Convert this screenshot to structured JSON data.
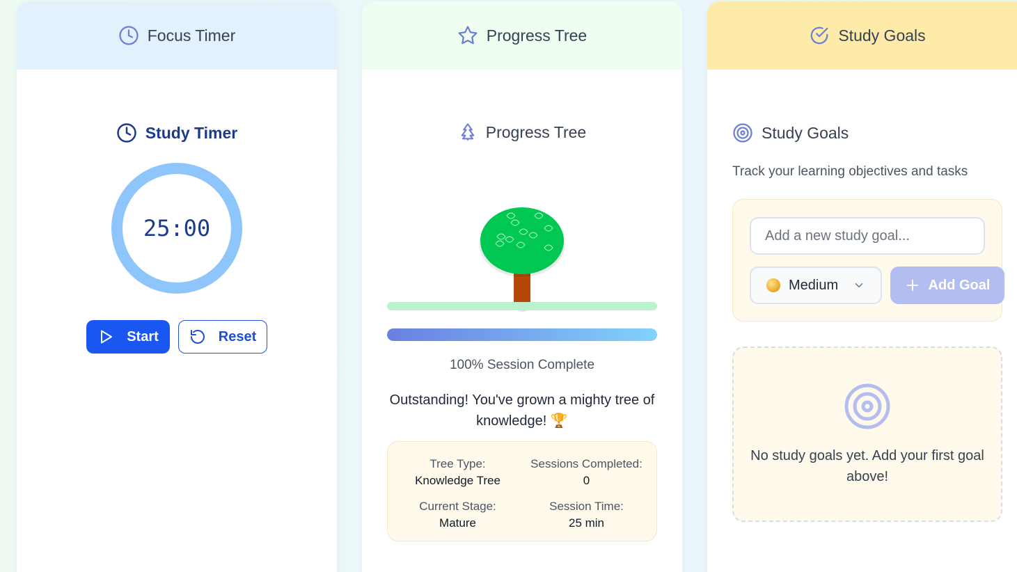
{
  "colors": {
    "accent_blue": "#1a57f0",
    "timer_ring": "#8ec5fb",
    "tree_foliage": "#00c853",
    "tree_trunk": "#b54708",
    "goals_header": "#feeaa9"
  },
  "timer_card": {
    "header_title": "Focus Timer",
    "header_icon": "clock-icon",
    "title": "Study Timer",
    "display": "25:00",
    "start_label": "Start",
    "reset_label": "Reset"
  },
  "tree_card": {
    "header_title": "Progress Tree",
    "header_icon": "star-icon",
    "title": "Progress Tree",
    "title_icon": "tree-icon",
    "progress_percent": 100,
    "session_text": "100% Session Complete",
    "message": "Outstanding! You've grown a mighty tree of knowledge! 🏆",
    "stats": {
      "tree_type_label": "Tree Type:",
      "tree_type_value": "Knowledge Tree",
      "sessions_label": "Sessions Completed:",
      "sessions_value": "0",
      "stage_label": "Current Stage:",
      "stage_value": "Mature",
      "time_label": "Session Time:",
      "time_value": "25 min"
    }
  },
  "goals_card": {
    "header_title": "Study Goals",
    "header_icon": "check-circle-icon",
    "title": "Study Goals",
    "title_icon": "target-icon",
    "subtitle": "Track your learning objectives and tasks",
    "input_placeholder": "Add a new study goal...",
    "input_value": "",
    "priority_selected": "Medium",
    "add_button_label": "Add Goal",
    "empty_message": "No study goals yet. Add your first goal above!"
  }
}
